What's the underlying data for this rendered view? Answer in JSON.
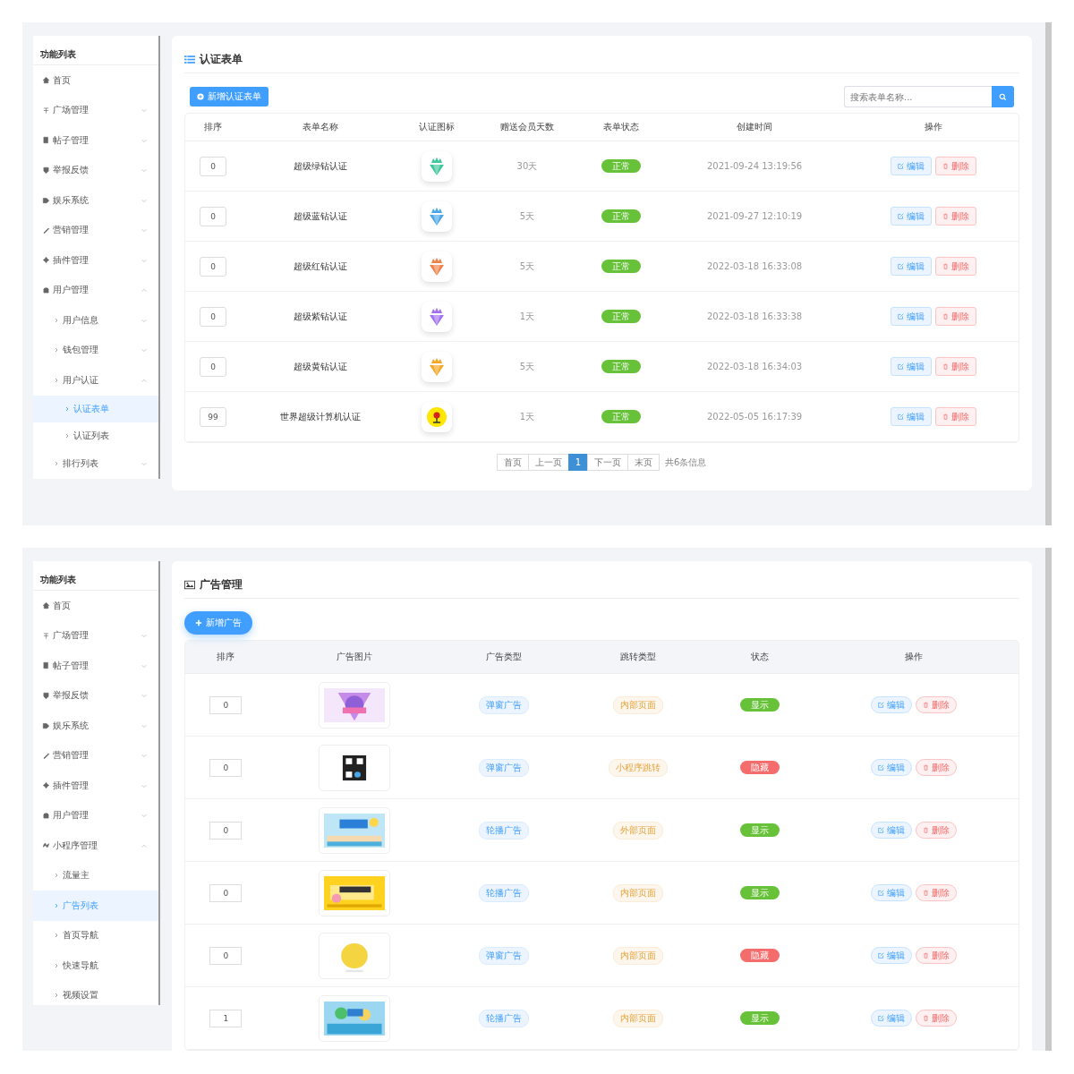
{
  "screens": [
    {
      "sidebar": {
        "title": "功能列表",
        "items": [
          {
            "label": "首页"
          },
          {
            "label": "广场管理",
            "expanded": false
          },
          {
            "label": "帖子管理",
            "expanded": false
          },
          {
            "label": "举报反馈",
            "expanded": false
          },
          {
            "label": "娱乐系统",
            "expanded": false
          },
          {
            "label": "营销管理",
            "expanded": false
          },
          {
            "label": "插件管理",
            "expanded": false
          },
          {
            "label": "用户管理",
            "expanded": true,
            "children": [
              {
                "label": "用户信息",
                "expanded": false,
                "selected": false
              },
              {
                "label": "钱包管理",
                "expanded": false,
                "selected": false
              },
              {
                "label": "用户认证",
                "expanded": true,
                "selected": false,
                "children": [
                  {
                    "label": "认证表单",
                    "selected": true
                  },
                  {
                    "label": "认证列表",
                    "selected": false
                  }
                ]
              },
              {
                "label": "排行列表",
                "expanded": false,
                "selected": false
              }
            ]
          }
        ]
      },
      "main": {
        "kind": "forms",
        "title": "认证表单",
        "add_button": "新增认证表单",
        "search": {
          "placeholder": "搜索表单名称..."
        },
        "columns": [
          "排序",
          "表单名称",
          "认证图标",
          "赠送会员天数",
          "表单状态",
          "创建时间",
          "操作"
        ],
        "rows": [
          {
            "sort": "0",
            "name": "超级绿钻认证",
            "icon": {
              "kind": "gem",
              "color": "#3cc79a"
            },
            "days": "30天",
            "status": "正常",
            "created": "2021-09-24 13:19:56",
            "edit": "编辑",
            "delete": "删除"
          },
          {
            "sort": "0",
            "name": "超级蓝钻认证",
            "icon": {
              "kind": "gem",
              "color": "#4aa6ea"
            },
            "days": "5天",
            "status": "正常",
            "created": "2021-09-27 12:10:19",
            "edit": "编辑",
            "delete": "删除"
          },
          {
            "sort": "0",
            "name": "超级红钻认证",
            "icon": {
              "kind": "gem",
              "color": "#f0804a"
            },
            "days": "5天",
            "status": "正常",
            "created": "2022-03-18 16:33:08",
            "edit": "编辑",
            "delete": "删除"
          },
          {
            "sort": "0",
            "name": "超级紫钻认证",
            "icon": {
              "kind": "gem",
              "color": "#a070f0"
            },
            "days": "1天",
            "status": "正常",
            "created": "2022-03-18 16:33:38",
            "edit": "编辑",
            "delete": "删除"
          },
          {
            "sort": "0",
            "name": "超级黄钻认证",
            "icon": {
              "kind": "gem",
              "color": "#f5a623"
            },
            "days": "5天",
            "status": "正常",
            "created": "2022-03-18 16:34:03",
            "edit": "编辑",
            "delete": "删除"
          },
          {
            "sort": "99",
            "name": "世界超级计算机认证",
            "icon": {
              "kind": "pin",
              "color": "#ffe600"
            },
            "days": "1天",
            "status": "正常",
            "created": "2022-05-05 16:17:39",
            "edit": "编辑",
            "delete": "删除"
          }
        ],
        "pagination": {
          "pages": [
            {
              "label": "首页",
              "selected": false
            },
            {
              "label": "上一页",
              "selected": false
            },
            {
              "label": "1",
              "selected": true
            },
            {
              "label": "下一页",
              "selected": false
            },
            {
              "label": "末页",
              "selected": false
            }
          ],
          "summary": "共6条信息"
        }
      }
    },
    {
      "sidebar": {
        "title": "功能列表",
        "items": [
          {
            "label": "首页"
          },
          {
            "label": "广场管理",
            "expanded": false
          },
          {
            "label": "帖子管理",
            "expanded": false
          },
          {
            "label": "举报反馈",
            "expanded": false
          },
          {
            "label": "娱乐系统",
            "expanded": false
          },
          {
            "label": "营销管理",
            "expanded": false
          },
          {
            "label": "插件管理",
            "expanded": false
          },
          {
            "label": "用户管理",
            "expanded": false
          },
          {
            "label": "小程序管理",
            "expanded": true,
            "children": [
              {
                "label": "流量主",
                "selected": false
              },
              {
                "label": "广告列表",
                "selected": true
              },
              {
                "label": "首页导航",
                "selected": false
              },
              {
                "label": "快速导航",
                "selected": false
              },
              {
                "label": "视频设置",
                "selected": false
              }
            ]
          }
        ]
      },
      "main": {
        "kind": "ads",
        "title": "广告管理",
        "add_button": "新增广告",
        "columns": [
          "排序",
          "广告图片",
          "广告类型",
          "跳转类型",
          "状态",
          "操作"
        ],
        "rows": [
          {
            "sort": "0",
            "ad_type": "弹窗广告",
            "jump_type": "内部页面",
            "status": "显示",
            "visible": true,
            "edit": "编辑",
            "delete": "删除"
          },
          {
            "sort": "0",
            "ad_type": "弹窗广告",
            "jump_type": "小程序跳转",
            "status": "隐藏",
            "visible": false,
            "edit": "编辑",
            "delete": "删除"
          },
          {
            "sort": "0",
            "ad_type": "轮播广告",
            "jump_type": "外部页面",
            "status": "显示",
            "visible": true,
            "edit": "编辑",
            "delete": "删除"
          },
          {
            "sort": "0",
            "ad_type": "轮播广告",
            "jump_type": "内部页面",
            "status": "显示",
            "visible": true,
            "edit": "编辑",
            "delete": "删除"
          },
          {
            "sort": "0",
            "ad_type": "弹窗广告",
            "jump_type": "内部页面",
            "status": "隐藏",
            "visible": false,
            "edit": "编辑",
            "delete": "删除"
          },
          {
            "sort": "1",
            "ad_type": "轮播广告",
            "jump_type": "内部页面",
            "status": "显示",
            "visible": true,
            "edit": "编辑",
            "delete": "删除"
          }
        ]
      }
    }
  ]
}
